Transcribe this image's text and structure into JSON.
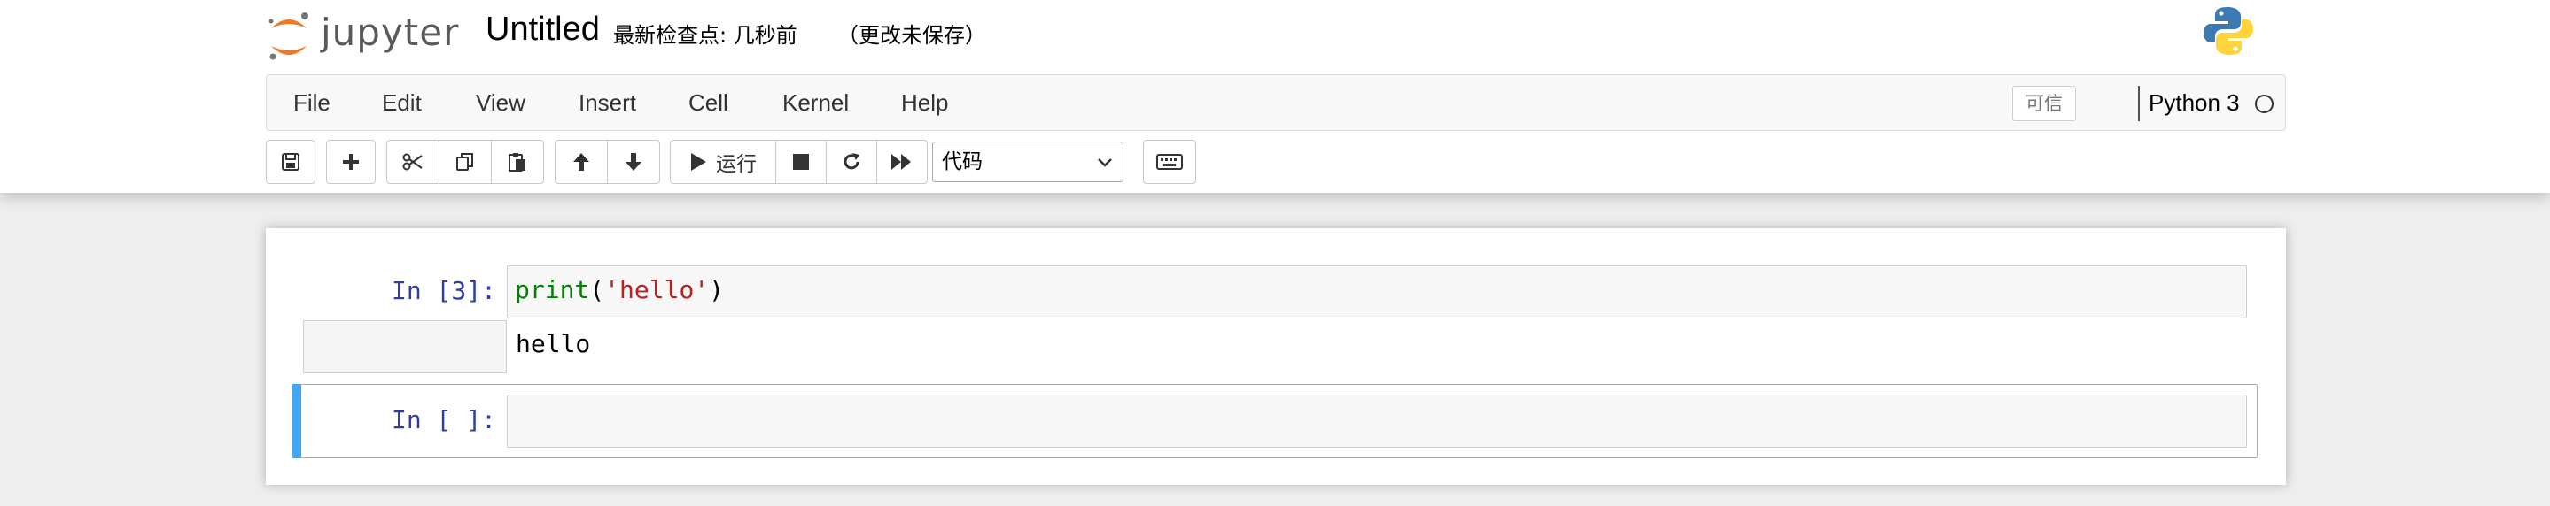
{
  "header": {
    "logo_text": "jupyter",
    "notebook_title": "Untitled",
    "checkpoint": "最新检查点: 几秒前",
    "autosave_status": "（更改未保存）"
  },
  "menubar": {
    "items": [
      "File",
      "Edit",
      "View",
      "Insert",
      "Cell",
      "Kernel",
      "Help"
    ],
    "trusted_label": "可信",
    "kernel_name": "Python 3"
  },
  "toolbar": {
    "run_label": "运行",
    "cell_type_selected": "代码",
    "icons": [
      "save-icon",
      "plus-icon",
      "cut-icon",
      "copy-icon",
      "paste-icon",
      "arrow-up-icon",
      "arrow-down-icon",
      "play-icon",
      "stop-icon",
      "restart-icon",
      "fast-forward-icon",
      "keyboard-icon"
    ]
  },
  "cells": [
    {
      "prompt": "In [3]:",
      "code_tokens": [
        {
          "text": "print",
          "kind": "builtin"
        },
        {
          "text": "(",
          "kind": "punc"
        },
        {
          "text": "'hello'",
          "kind": "string"
        },
        {
          "text": ")",
          "kind": "punc"
        }
      ],
      "output": "hello"
    },
    {
      "prompt": "In [ ]:",
      "code": ""
    }
  ],
  "colors": {
    "prompt": "#303f9f",
    "selected_cell_bar": "#42a5f5",
    "logo_orange": "#f37726",
    "python_blue": "#3d7ab4",
    "python_yellow": "#ffd43b"
  }
}
